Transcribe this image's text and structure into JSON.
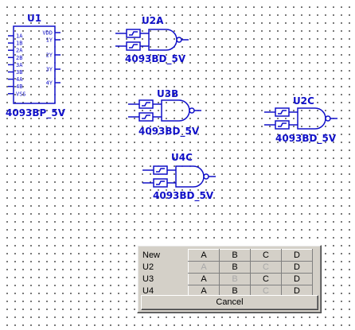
{
  "components": {
    "u1": {
      "ref": "U1",
      "part": "4093BP_5V",
      "left_pins": [
        "1A",
        "1B",
        "2A",
        "2B",
        "3A",
        "3B",
        "4A",
        "4B",
        "VSS"
      ],
      "right_pins": [
        "VDD",
        "1Y",
        "2Y",
        "3Y",
        "4Y"
      ]
    },
    "u2a": {
      "ref": "U2A",
      "part": "4093BD_5V"
    },
    "u3b": {
      "ref": "U3B",
      "part": "4093BD_5V"
    },
    "u2c": {
      "ref": "U2C",
      "part": "4093BD_5V"
    },
    "u4c": {
      "ref": "U4C",
      "part": "4093BD_5V"
    }
  },
  "gate_selector": {
    "rows": [
      {
        "label": "New",
        "cells": [
          {
            "text": "A",
            "enabled": true
          },
          {
            "text": "B",
            "enabled": true
          },
          {
            "text": "C",
            "enabled": true
          },
          {
            "text": "D",
            "enabled": true
          }
        ]
      },
      {
        "label": "U2",
        "cells": [
          {
            "text": "A",
            "enabled": false
          },
          {
            "text": "B",
            "enabled": true
          },
          {
            "text": "C",
            "enabled": false
          },
          {
            "text": "D",
            "enabled": true
          }
        ]
      },
      {
        "label": "U3",
        "cells": [
          {
            "text": "A",
            "enabled": true
          },
          {
            "text": "B",
            "enabled": false
          },
          {
            "text": "C",
            "enabled": true
          },
          {
            "text": "D",
            "enabled": true
          }
        ]
      },
      {
        "label": "U4",
        "cells": [
          {
            "text": "A",
            "enabled": true
          },
          {
            "text": "B",
            "enabled": true
          },
          {
            "text": "C",
            "enabled": false
          },
          {
            "text": "D",
            "enabled": true
          }
        ]
      }
    ],
    "cancel_label": "Cancel"
  },
  "colors": {
    "component": "#1010c8",
    "dialog_face": "#d4d0c8",
    "disabled_text": "#a8a8a8"
  }
}
